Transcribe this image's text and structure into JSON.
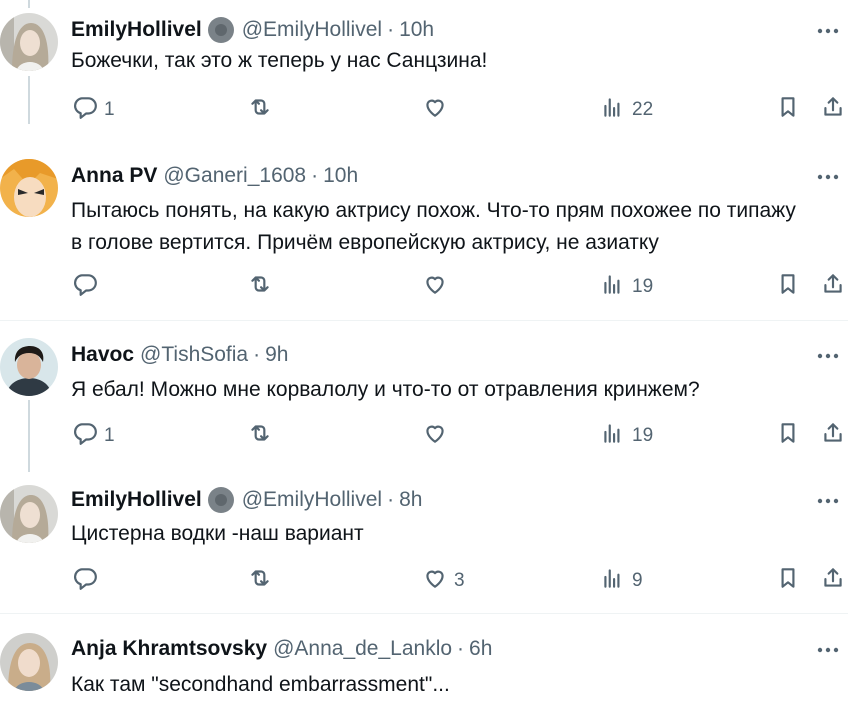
{
  "tweets": [
    {
      "name": "EmilyHollivel",
      "verified_badge": true,
      "handle": "@EmilyHollivel",
      "time": "10h",
      "text_lines": [
        "Божечки, так это ж теперь у нас Санцзина!"
      ],
      "replies": "1",
      "retweets": "",
      "likes": "",
      "views": "22",
      "avatar": "emily-avatar"
    },
    {
      "name": "Anna PV",
      "verified_badge": false,
      "handle": "@Ganeri_1608",
      "time": "10h",
      "text_lines": [
        "Пытаюсь понять, на какую актрису похож. Что-то прям похожее по типажу",
        "в голове вертится. Причём европейскую актрису, не азиатку"
      ],
      "replies": "",
      "retweets": "",
      "likes": "",
      "views": "19",
      "avatar": "anime-avatar"
    },
    {
      "name": "Havoc",
      "verified_badge": false,
      "handle": "@TishSofia",
      "time": "9h",
      "text_lines": [
        "Я ебал! Можно мне корвалолу и что-то от отравления кринжем?"
      ],
      "replies": "1",
      "retweets": "",
      "likes": "",
      "views": "19",
      "avatar": "man-avatar"
    },
    {
      "name": "EmilyHollivel",
      "verified_badge": true,
      "handle": "@EmilyHollivel",
      "time": "8h",
      "text_lines": [
        "Цистерна водки -наш вариант"
      ],
      "replies": "",
      "retweets": "",
      "likes": "3",
      "views": "9",
      "avatar": "emily-avatar"
    },
    {
      "name": "Anja Khramtsovsky",
      "verified_badge": false,
      "handle": "@Anna_de_Lanklo",
      "time": "6h",
      "text_lines": [
        "Как там \"secondhand embarrassment\"..."
      ],
      "replies": "",
      "retweets": "",
      "likes": "",
      "views": "",
      "avatar": "girl-avatar"
    }
  ],
  "icons": {
    "reply": "reply-icon",
    "retweet": "retweet-icon",
    "like": "heart-icon",
    "views": "views-icon",
    "bookmark": "bookmark-icon",
    "share": "share-icon",
    "more": "more-icon",
    "verified": "verified-badge-icon"
  },
  "colors": {
    "text": "#0f1419",
    "secondary": "#536471",
    "thread_line": "#cfd9de",
    "divider": "#eff3f4"
  }
}
